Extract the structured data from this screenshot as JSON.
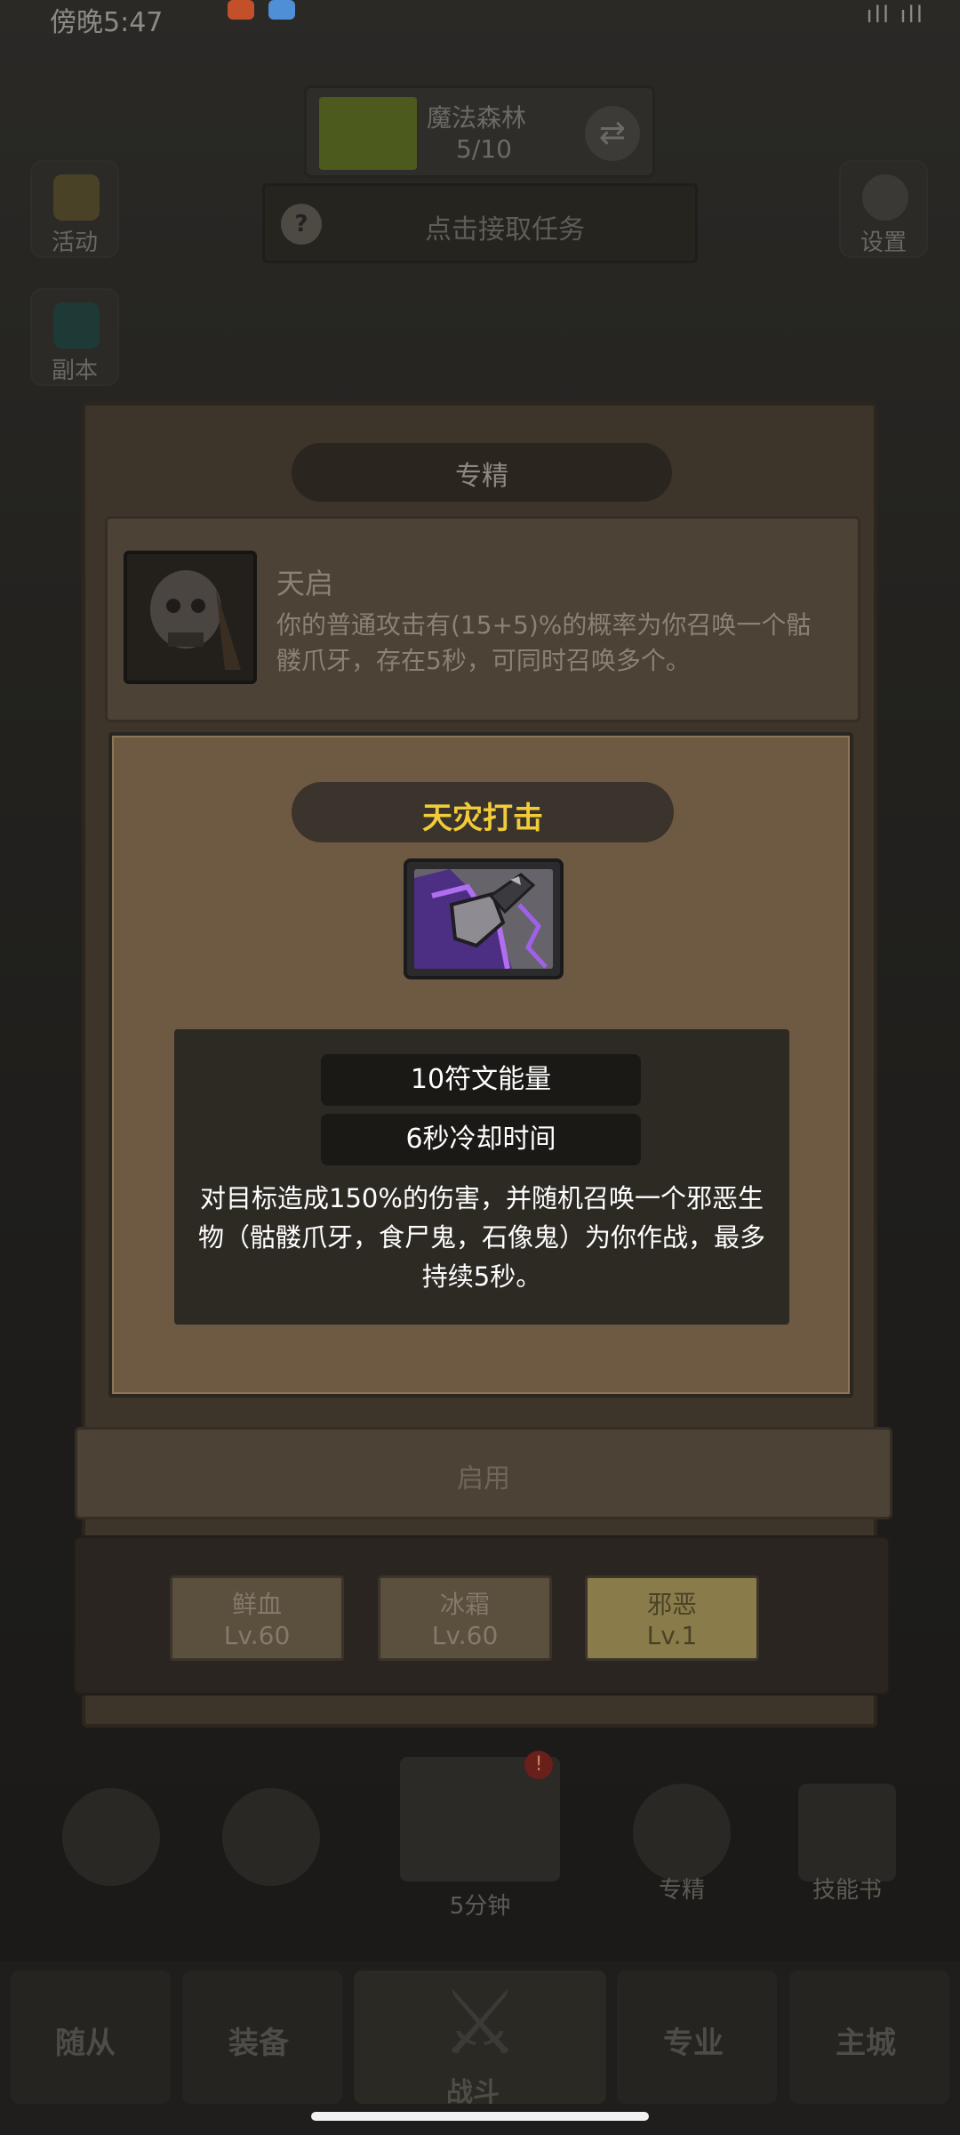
{
  "status_bar": {
    "time": "傍晚5:47",
    "right_text": "ıll ıll"
  },
  "background": {
    "level": {
      "name": "魔法森林",
      "progress": "5/10"
    },
    "quest": {
      "icon_text": "?",
      "label": "点击接取任务"
    },
    "side_buttons": {
      "events": "活动",
      "dungeon": "副本",
      "settings": "设置"
    },
    "bottom_items": {
      "afk_timer": "5分钟",
      "specialization": "专精",
      "skill_book": "技能书",
      "badge": "!"
    },
    "nav_tabs": [
      "随从",
      "装备",
      "战斗",
      "专业",
      "主城"
    ]
  },
  "outer_dialog": {
    "title": "专精",
    "talent": {
      "name": "天启",
      "description": "你的普通攻击有(15+5)%的概率为你召唤一个骷髅爪牙，存在5秒，可同时召唤多个。"
    },
    "enable_button": "启用",
    "spec_tabs": [
      {
        "name": "鲜血",
        "level": "Lv.60"
      },
      {
        "name": "冰霜",
        "level": "Lv.60"
      },
      {
        "name": "邪恶",
        "level": "Lv.1"
      }
    ]
  },
  "popup": {
    "title": "天灾打击",
    "skill_icon": "unholy-fist-icon",
    "cost": "10符文能量",
    "cooldown": "6秒冷却时间",
    "description": "对目标造成150%的伤害，并随机召唤一个邪恶生物（骷髅爪牙，食尸鬼，石像鬼）为你作战，最多持续5秒。"
  },
  "colors": {
    "popup_bg": "#6e5a43",
    "title_gold": "#f2cb3a",
    "panel_dark": "#2d2923"
  }
}
